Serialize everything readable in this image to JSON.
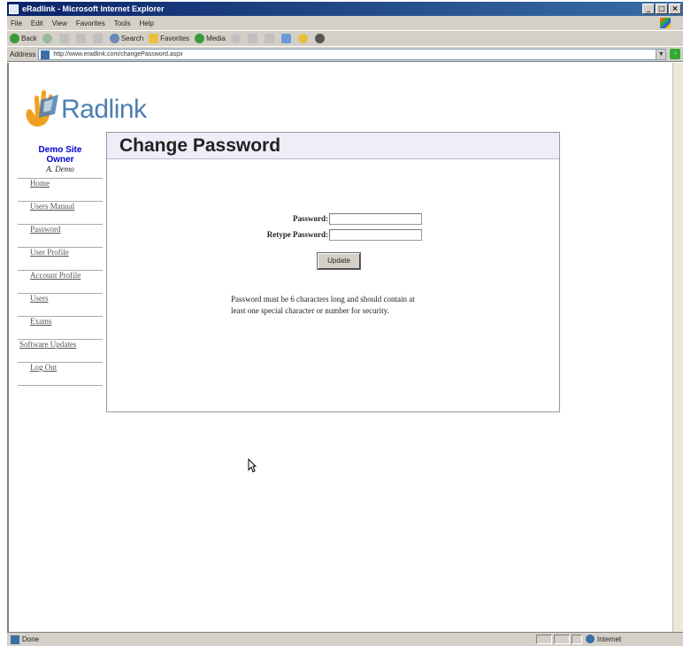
{
  "window": {
    "title": "eRadlink - Microsoft Internet Explorer",
    "controls": [
      "_",
      "□",
      "×"
    ]
  },
  "menu": [
    "File",
    "Edit",
    "View",
    "Favorites",
    "Tools",
    "Help"
  ],
  "toolbar": {
    "back_label": "Back",
    "search_label": "Search",
    "favorites_label": "Favorites",
    "media_label": "Media"
  },
  "address": {
    "label": "Address",
    "url": "http://www.eradlink.com/changePassword.aspx"
  },
  "logo": {
    "text": "Radlink"
  },
  "sidebar": {
    "site": "Demo Site",
    "role": "Owner",
    "user": "A. Demo",
    "nav": [
      {
        "label": "Home"
      },
      {
        "label": "Users Manual"
      },
      {
        "label": "Password"
      },
      {
        "label": "User Profile"
      },
      {
        "label": "Account Profile"
      },
      {
        "label": "Users"
      },
      {
        "label": "Exams"
      },
      {
        "label": "Software Updates"
      },
      {
        "label": "Log Out"
      }
    ]
  },
  "page": {
    "title": "Change Password",
    "password_label": "Password:",
    "retype_label": "Retype Password:",
    "update_label": "Update",
    "note": "Password must be 6 characters long and should contain at least one special character or number for security."
  },
  "status": {
    "left": "Done",
    "zone": "Internet"
  }
}
